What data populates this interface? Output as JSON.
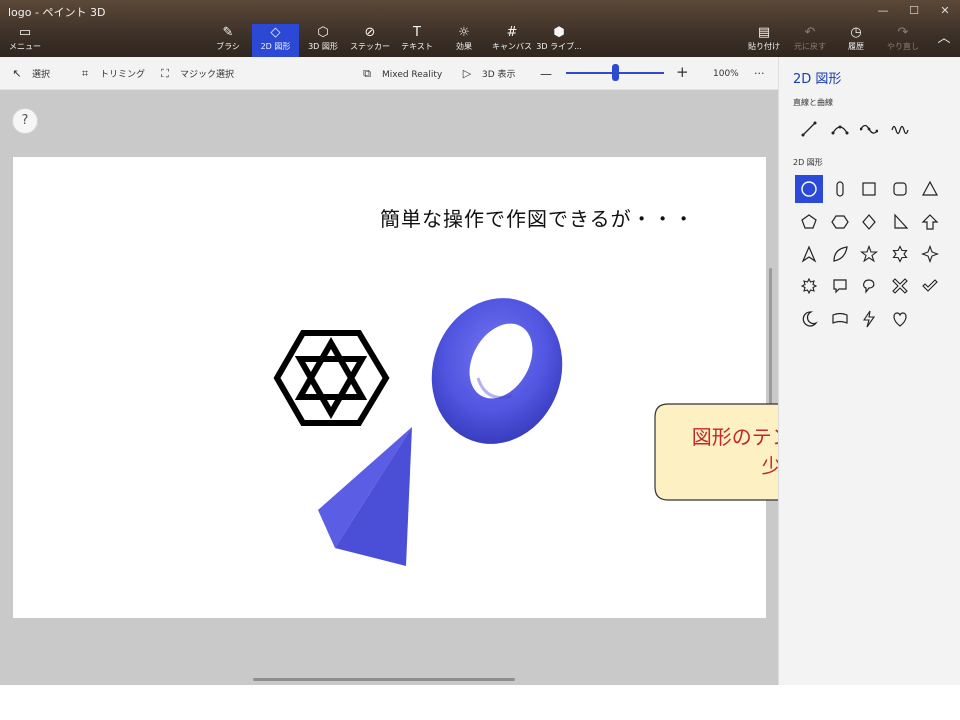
{
  "window": {
    "title": "logo - ペイント 3D"
  },
  "ribbon": {
    "menu": {
      "label": "メニュー",
      "icon": "folder-icon"
    },
    "tools": [
      {
        "label": "ブラシ",
        "icon": "brush-icon"
      },
      {
        "label": "2D 図形",
        "icon": "2d-shapes-icon",
        "active": true
      },
      {
        "label": "3D 図形",
        "icon": "3d-shapes-icon"
      },
      {
        "label": "ステッカー",
        "icon": "sticker-icon"
      },
      {
        "label": "テキスト",
        "icon": "text-icon"
      },
      {
        "label": "効果",
        "icon": "effects-icon"
      },
      {
        "label": "キャンバス",
        "icon": "canvas-icon"
      },
      {
        "label": "3D ライブ...",
        "icon": "3d-library-icon"
      }
    ],
    "right": [
      {
        "label": "貼り付け",
        "icon": "paste-icon"
      },
      {
        "label": "元に戻す",
        "icon": "undo-icon",
        "disabled": true
      },
      {
        "label": "履歴",
        "icon": "history-icon"
      },
      {
        "label": "やり直し",
        "icon": "redo-icon",
        "disabled": true
      }
    ]
  },
  "toolbar": {
    "select": "選択",
    "crop": "トリミング",
    "magic_select": "マジック選択",
    "mixed_reality": "Mixed Reality",
    "view_3d": "3D 表示",
    "zoom_minus": "—",
    "zoom_plus": "+",
    "zoom": "100%",
    "more": "···",
    "zoom_level": 0.5
  },
  "canvas": {
    "text": "簡単な操作で作図できるが・・・",
    "help": "?"
  },
  "panel": {
    "title": "2D 図形",
    "lines_section": "直線と曲線",
    "shapes_section": "2D 図形",
    "selected_shape": "circle"
  },
  "callout": {
    "line1": "図形のテンプレートは",
    "line2": "少ない",
    "fill": "#fdf1c4",
    "text_color": "#c0292a"
  },
  "colors": {
    "accent": "#2b4ad8",
    "shape_blue": "#5458e0"
  }
}
